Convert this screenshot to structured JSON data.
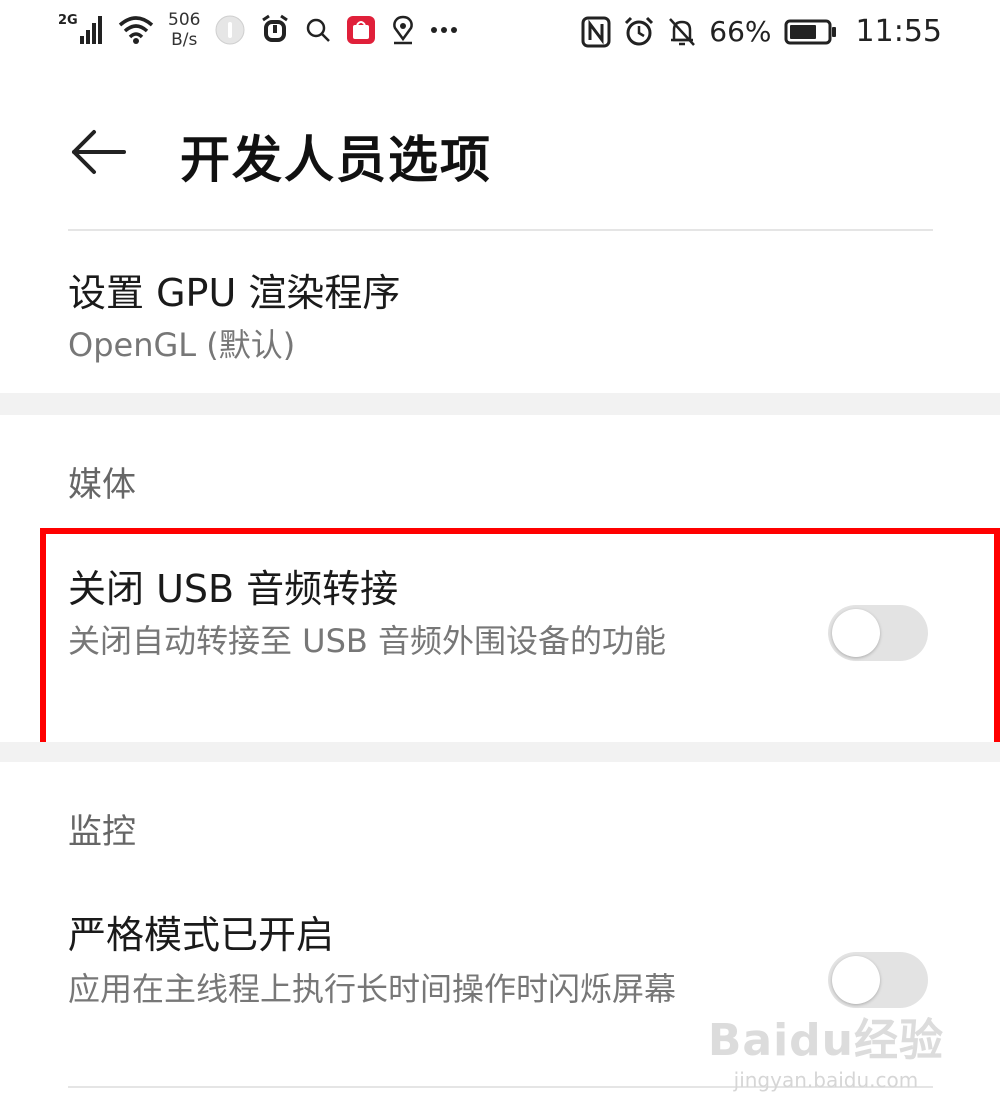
{
  "status_bar": {
    "signal_label": "2G",
    "net_rate_value": "506",
    "net_rate_unit": "B/s",
    "battery_percent": "66%",
    "time": "11:55"
  },
  "header": {
    "title": "开发人员选项"
  },
  "gpu_renderer": {
    "title": "设置 GPU 渲染程序",
    "value": "OpenGL (默认)"
  },
  "media_section": {
    "header": "媒体",
    "usb_audio": {
      "title": "关闭 USB 音频转接",
      "description": "关闭自动转接至 USB 音频外围设备的功能",
      "enabled": false
    }
  },
  "monitor_section": {
    "header": "监控",
    "strict_mode": {
      "title": "严格模式已开启",
      "description": "应用在主线程上执行长时间操作时闪烁屏幕",
      "enabled": false
    }
  },
  "watermark": {
    "logo": "Baidu经验",
    "url": "jingyan.baidu.com"
  },
  "colors": {
    "highlight": "#ff0000",
    "toggle_off": "#e3e3e3",
    "section_gap": "#f2f2f2"
  }
}
